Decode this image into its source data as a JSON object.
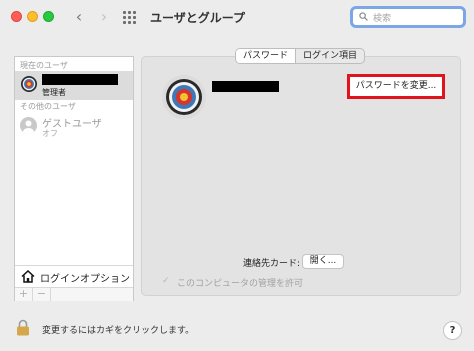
{
  "window": {
    "title": "ユーザとグループ",
    "back_icon": "‹",
    "forward_icon": "›"
  },
  "search": {
    "placeholder": "検索"
  },
  "sidebar": {
    "current_users_label": "現在のユーザ",
    "current_user": {
      "role": "管理者"
    },
    "other_users_label": "その他のユーザ",
    "guest": {
      "name": "ゲストユーザ",
      "status": "オフ"
    },
    "login_options_label": "ログインオプション",
    "add_label": "+",
    "remove_label": "−"
  },
  "tabs": [
    {
      "label": "パスワード",
      "active": true
    },
    {
      "label": "ログイン項目",
      "active": false
    }
  ],
  "main": {
    "change_password_label": "パスワードを変更...",
    "contact_card_label": "連絡先カード:",
    "open_button_label": "開く...",
    "admin_checkbox_label": "このコンピュータの管理を許可",
    "admin_checkbox_mark": "✓"
  },
  "footer": {
    "lock_text": "変更するにはカギをクリックします。",
    "help_label": "?"
  },
  "colors": {
    "highlight_box": "#e2141b",
    "search_focus": "#7ba7e4"
  }
}
